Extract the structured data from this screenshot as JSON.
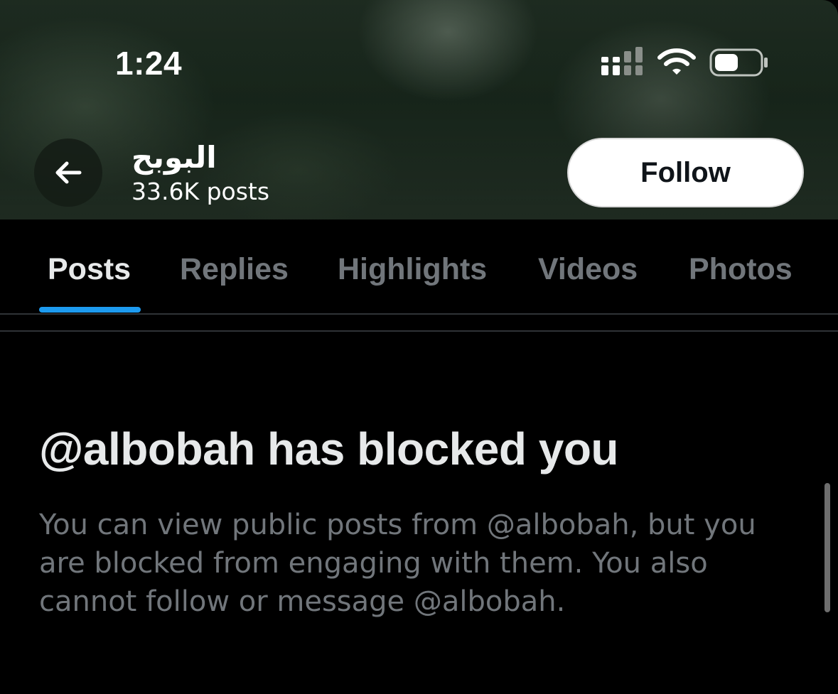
{
  "status_bar": {
    "time": "1:24",
    "signal_icon": "cellular-signal-icon",
    "wifi_icon": "wifi-icon",
    "battery_icon": "battery-icon"
  },
  "header": {
    "back_icon": "arrow-left-icon",
    "name": "البوبح",
    "posts_count": "33.6K posts",
    "follow_label": "Follow"
  },
  "tabs": [
    {
      "label": "Posts",
      "active": true
    },
    {
      "label": "Replies",
      "active": false
    },
    {
      "label": "Highlights",
      "active": false
    },
    {
      "label": "Videos",
      "active": false
    },
    {
      "label": "Photos",
      "active": false
    }
  ],
  "blocked": {
    "title": "@albobah has blocked you",
    "description": "You can view public posts from @albobah, but you are blocked from engaging with them. You also cannot follow or message @albobah."
  },
  "colors": {
    "background": "#000000",
    "accent": "#1d9bf0",
    "text_primary": "#e7e9ea",
    "text_secondary": "#71767b"
  }
}
